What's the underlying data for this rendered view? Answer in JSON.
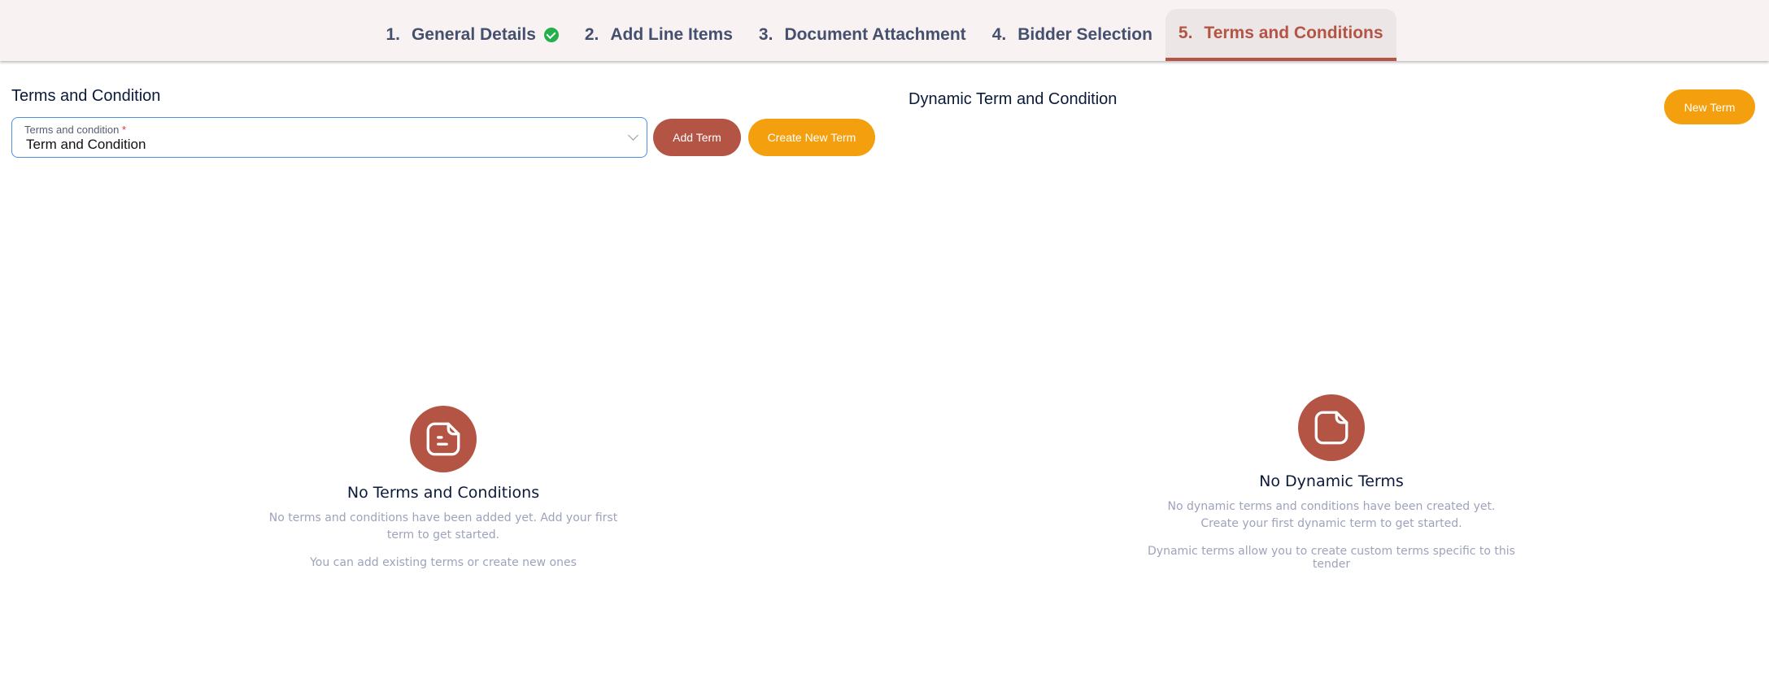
{
  "steps": [
    {
      "num": "1.",
      "label": "General Details",
      "completed": true
    },
    {
      "num": "2.",
      "label": "Add Line Items"
    },
    {
      "num": "3.",
      "label": "Document Attachment"
    },
    {
      "num": "4.",
      "label": "Bidder Selection"
    },
    {
      "num": "5.",
      "label": "Terms and Conditions",
      "active": true
    }
  ],
  "left": {
    "title": "Terms and Condition",
    "select": {
      "label": "Terms and condition",
      "required_mark": "*",
      "value": "Term and Condition"
    },
    "add_term": "Add Term",
    "create_new_term": "Create New Term",
    "empty": {
      "title": "No Terms and Conditions",
      "description": "No terms and conditions have been added yet. Add your first term to get started.",
      "note": "You can add existing terms or create new ones"
    }
  },
  "right": {
    "title": "Dynamic Term and Condition",
    "new_term": "New Term",
    "empty": {
      "title": "No Dynamic Terms",
      "description": "No dynamic terms and conditions have been created yet. Create your first dynamic term to get started.",
      "note": "Dynamic terms allow you to create custom terms specific to this tender"
    }
  },
  "colors": {
    "accent": "#b45445",
    "orange": "#f4a00e",
    "success": "#22b04a"
  }
}
